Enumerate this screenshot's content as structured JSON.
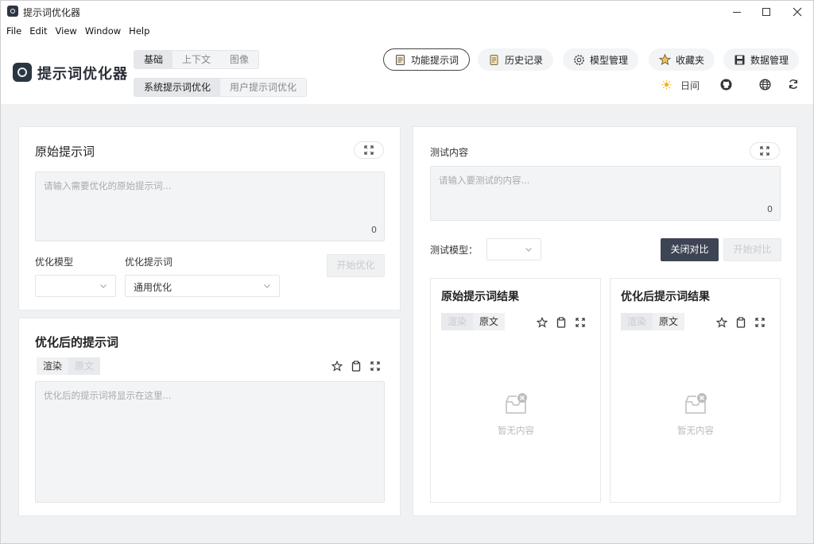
{
  "window": {
    "title": "提示词优化器",
    "minimize_icon": "minimize-icon",
    "maximize_icon": "maximize-icon",
    "close_icon": "close-icon"
  },
  "menu": [
    "File",
    "Edit",
    "View",
    "Window",
    "Help"
  ],
  "header": {
    "brand": "提示词优化器",
    "mode_tabs": [
      "基础",
      "上下文",
      "图像"
    ],
    "mode_active": "基础",
    "sub_tabs": [
      "系统提示词优化",
      "用户提示词优化"
    ],
    "sub_active": "系统提示词优化",
    "nav": [
      {
        "label": "功能提示词",
        "icon": "document-icon"
      },
      {
        "label": "历史记录",
        "icon": "scroll-icon"
      },
      {
        "label": "模型管理",
        "icon": "gear-icon"
      },
      {
        "label": "收藏夹",
        "icon": "star-icon"
      },
      {
        "label": "数据管理",
        "icon": "save-icon"
      }
    ],
    "theme_label": "日间",
    "theme_icon": "sun-icon",
    "github_icon": "github-icon",
    "language_icon": "globe-icon",
    "refresh_icon": "refresh-icon"
  },
  "original": {
    "title": "原始提示词",
    "placeholder": "请输入需要优化的原始提示词...",
    "count": "0",
    "model_label": "优化模型",
    "model_value": "",
    "template_label": "优化提示词",
    "template_value": "通用优化",
    "start_button": "开始优化"
  },
  "optimized": {
    "title": "优化后的提示词",
    "tab_render": "渲染",
    "tab_source": "原文",
    "placeholder": "优化后的提示词将显示在这里..."
  },
  "test": {
    "title": "测试内容",
    "placeholder": "请输入要测试的内容...",
    "count": "0",
    "model_label": "测试模型：",
    "model_value": "",
    "compare_button": "关闭对比",
    "run_button": "开始对比",
    "original_result_title": "原始提示词结果",
    "optimized_result_title": "优化后提示词结果",
    "tab_render": "渲染",
    "tab_source": "原文",
    "empty_text": "暂无内容"
  },
  "colors": {
    "accent_dark": "#3d4453",
    "background": "#eff1f3"
  }
}
